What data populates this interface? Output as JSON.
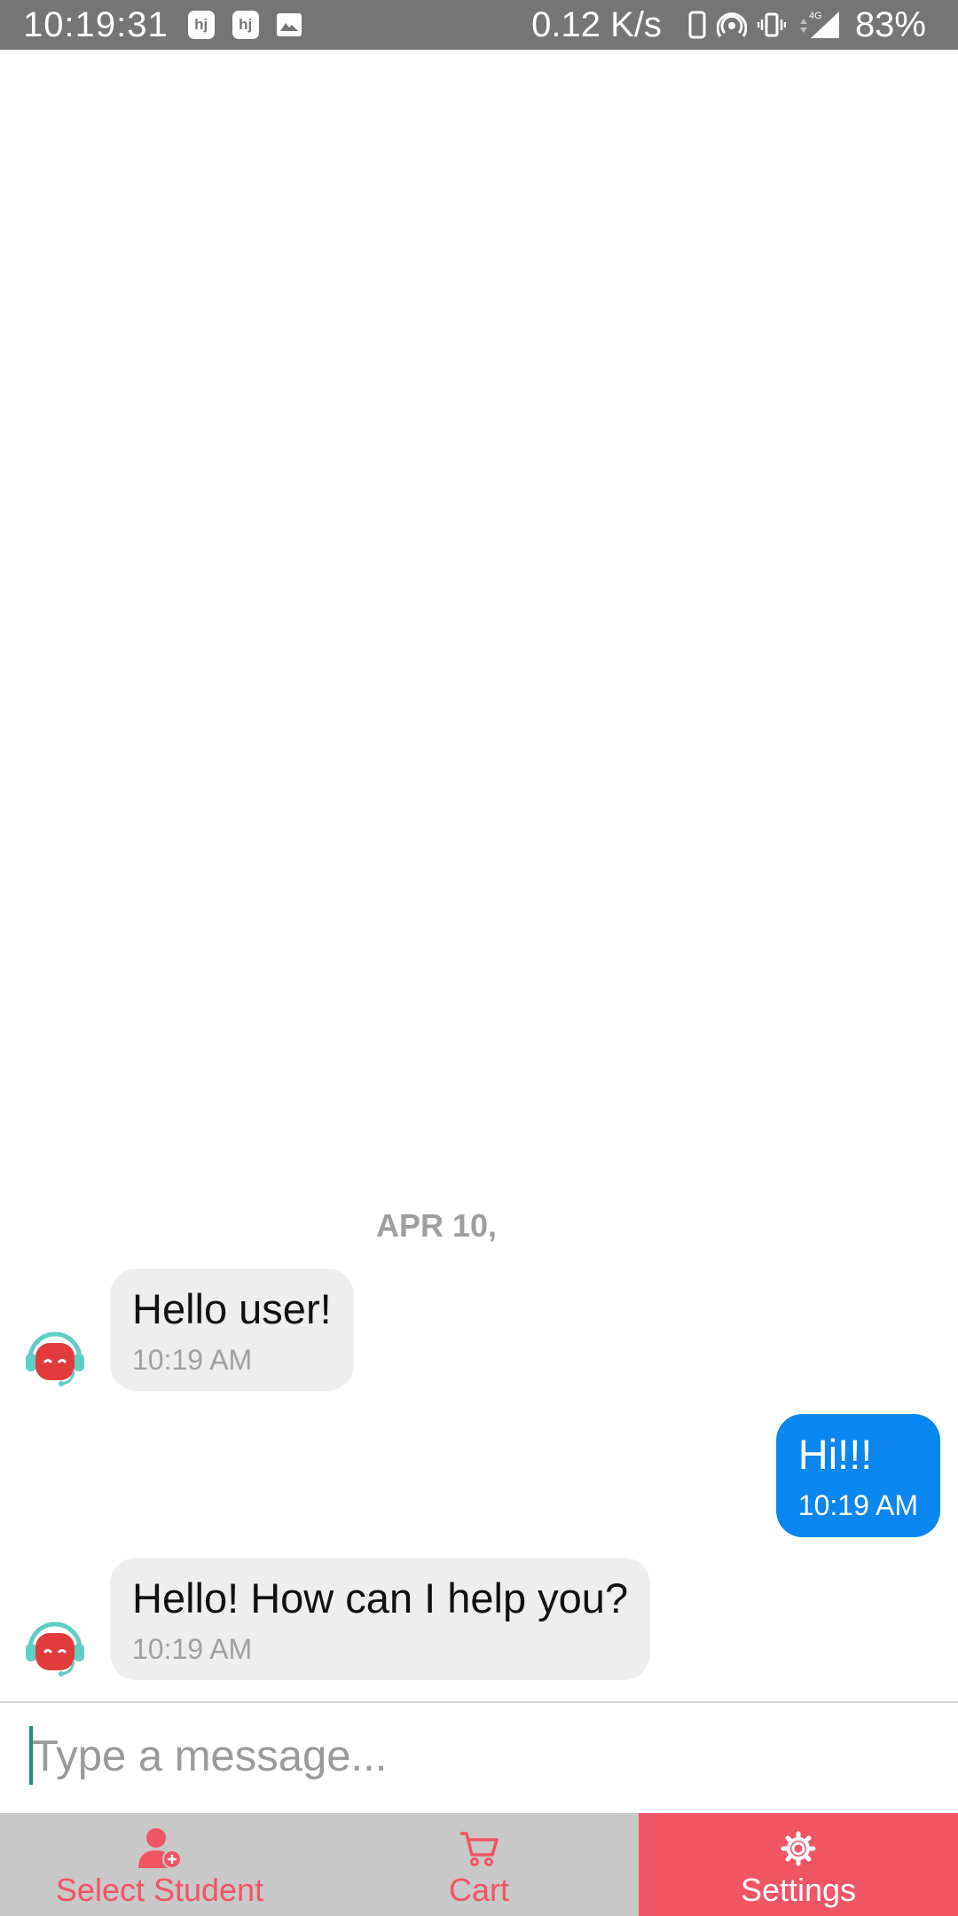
{
  "status_bar": {
    "time": "10:19:31",
    "notif_icons": [
      "hj",
      "hj",
      "image-icon"
    ],
    "network_speed": "0.12 K/s",
    "battery": "83%",
    "network_type": "4G"
  },
  "chat": {
    "date_separator": "APR 10,",
    "messages": [
      {
        "sender": "bot",
        "text": "Hello user!",
        "time": "10:19 AM"
      },
      {
        "sender": "user",
        "text": "Hi!!!",
        "time": "10:19 AM"
      },
      {
        "sender": "bot",
        "text": "Hello! How can I help you?",
        "time": "10:19 AM"
      }
    ]
  },
  "input": {
    "placeholder": "Type a message...",
    "value": ""
  },
  "bottom_nav": {
    "items": [
      {
        "label": "Select Student",
        "icon": "add-user-icon",
        "active": false
      },
      {
        "label": "Cart",
        "icon": "cart-icon",
        "active": false
      },
      {
        "label": "Settings",
        "icon": "gear-icon",
        "active": true
      }
    ]
  },
  "colors": {
    "accent": "#f05565",
    "user_bubble": "#0a86f0",
    "bot_bubble": "#eeeeee",
    "status_bar": "#757575",
    "nav_bg": "#c8c8c8"
  }
}
